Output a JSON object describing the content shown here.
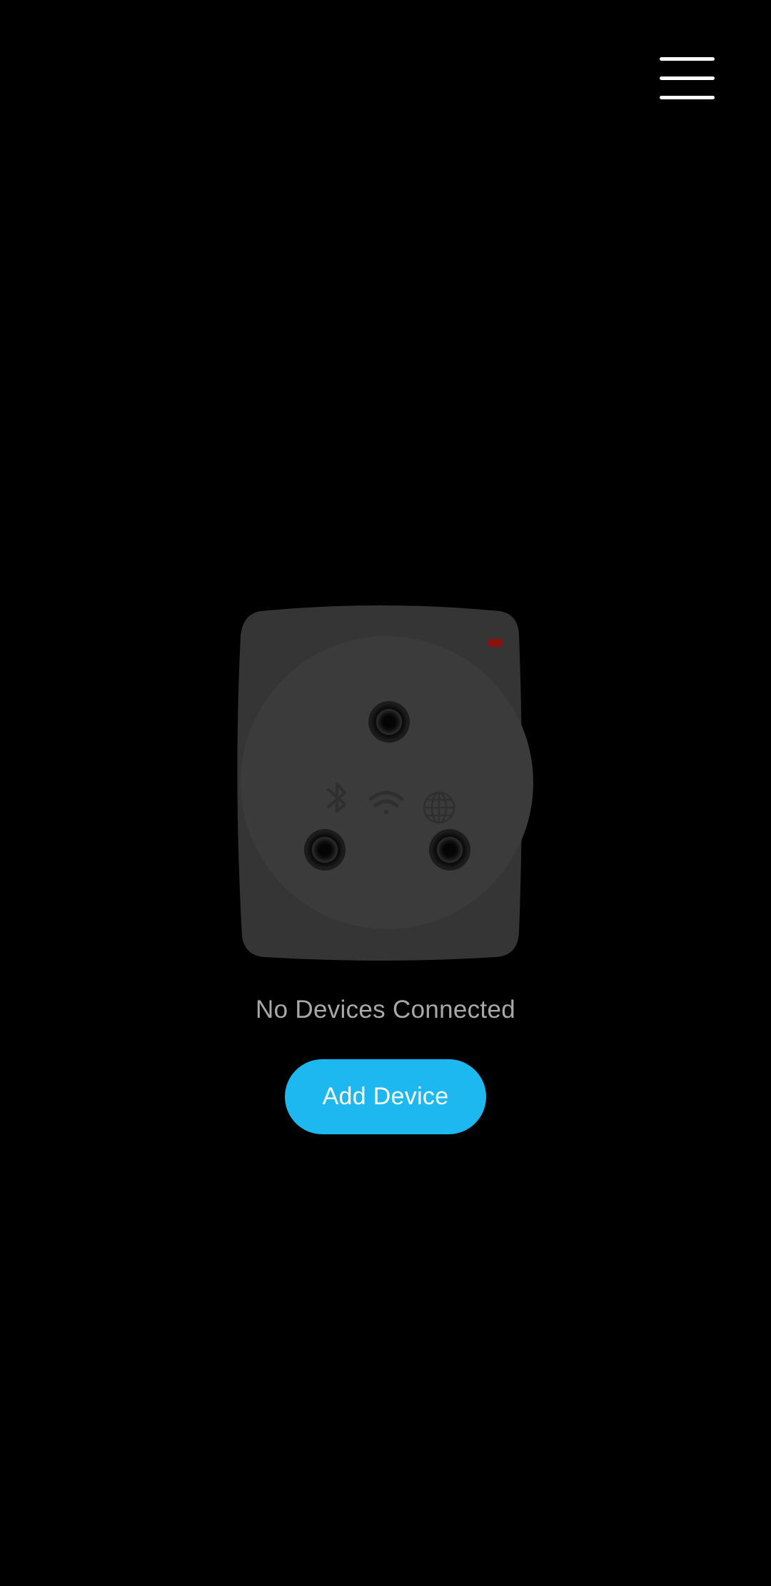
{
  "header": {
    "menu_icon": "hamburger-menu-icon"
  },
  "device_illustration": {
    "type": "smart-plug",
    "icons": [
      "bluetooth-icon",
      "wifi-icon",
      "globe-icon"
    ],
    "indicator_color": "#8b1111",
    "body_color": "#353535"
  },
  "status": {
    "text": "No Devices Connected"
  },
  "actions": {
    "add_device_label": "Add Device"
  },
  "colors": {
    "background": "#000000",
    "accent": "#1eb8f0",
    "status_text": "#a8a8a8"
  }
}
